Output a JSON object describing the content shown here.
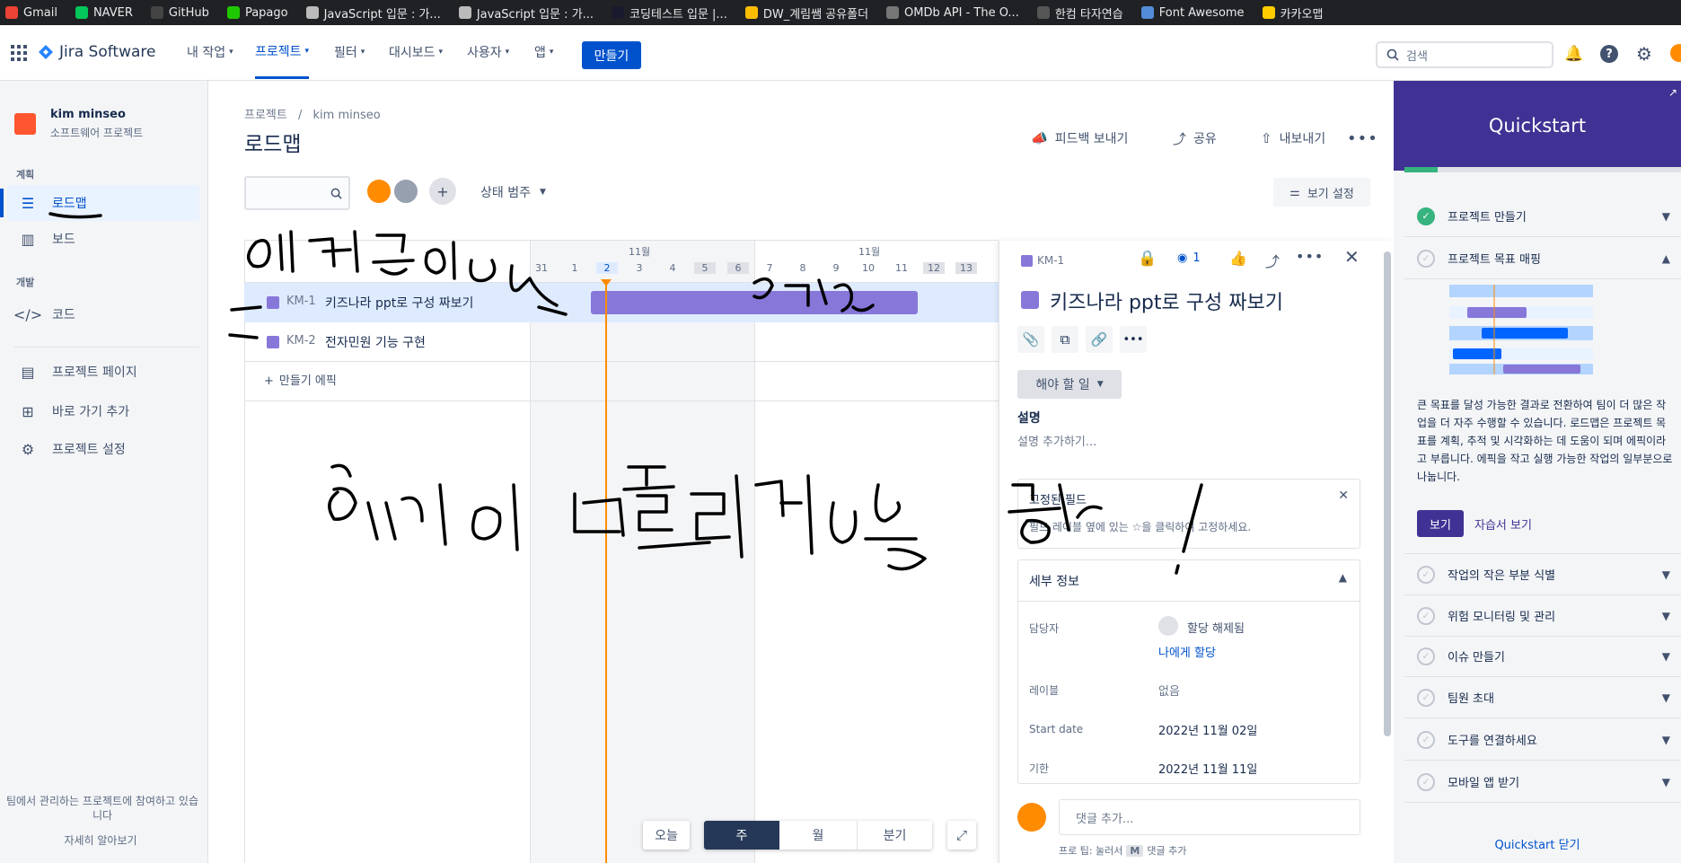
{
  "bookmarks": [
    {
      "label": "Gmail",
      "color": "#ea4335"
    },
    {
      "label": "NAVER",
      "color": "#03c75a"
    },
    {
      "label": "GitHub",
      "color": "#444"
    },
    {
      "label": "Papago",
      "color": "#1ec800"
    },
    {
      "label": "JavaScript 입문 : 가...",
      "color": "#bbb"
    },
    {
      "label": "JavaScript 입문 : 가...",
      "color": "#bbb"
    },
    {
      "label": "코딩테스트 입문 |...",
      "color": "#1a1a2e"
    },
    {
      "label": "DW_계림쌤 공유폴더",
      "color": "#fbbc04"
    },
    {
      "label": "OMDb API - The O...",
      "color": "#777"
    },
    {
      "label": "한컴 타자연습",
      "color": "#555"
    },
    {
      "label": "Font Awesome",
      "color": "#538dd7"
    },
    {
      "label": "카카오맵",
      "color": "#ffcd00"
    }
  ],
  "nav": {
    "brand": "Jira Software",
    "menus": [
      "내 작업",
      "프로젝트",
      "필터",
      "대시보드",
      "사용자",
      "앱"
    ],
    "create": "만들기",
    "search_placeholder": "검색"
  },
  "sidebar": {
    "project_name": "kim minseo",
    "project_type": "소프트웨어 프로젝트",
    "section_plan": "계획",
    "roadmap": "로드맵",
    "board": "보드",
    "section_dev": "개발",
    "code": "코드",
    "project_page": "프로젝트 페이지",
    "add_shortcut": "바로 가기 추가",
    "project_settings": "프로젝트 설정",
    "footer_text": "팀에서 관리하는 프로젝트에 참여하고 있습니다",
    "learn_more": "자세히 알아보기"
  },
  "main": {
    "breadcrumb_root": "프로젝트",
    "breadcrumb_sep": "/",
    "breadcrumb_project": "kim minseo",
    "title": "로드맵",
    "feedback": "피드백 보내기",
    "share": "공유",
    "export": "내보내기",
    "status_category": "상태 범주",
    "view_settings": "보기 설정",
    "month1": "11월",
    "month2": "11월",
    "days": [
      "31",
      "1",
      "2",
      "3",
      "4",
      "5",
      "6",
      "7",
      "8",
      "9",
      "10",
      "11",
      "12",
      "13"
    ],
    "rows": [
      {
        "key": "KM-1",
        "summary": "키즈나라 ppt로 구성 짜보기"
      },
      {
        "key": "KM-2",
        "summary": "전자민원 기능 구현"
      }
    ],
    "create_epic": "만들기 에픽",
    "today": "오늘",
    "scale": [
      "주",
      "월",
      "분기"
    ]
  },
  "panel": {
    "key": "KM-1",
    "watch_count": "1",
    "title": "키즈나라 ppt로 구성 짜보기",
    "status": "해야 할 일",
    "desc_label": "설명",
    "desc_placeholder": "설명 추가하기...",
    "pinned_title": "고정된 필드",
    "pinned_text": "필드 레이블 옆에 있는 ☆을 클릭하여 고정하세요.",
    "details_title": "세부 정보",
    "assignee_label": "담당자",
    "assignee_value": "할당 해제됨",
    "assign_me": "나에게 할당",
    "labels_label": "레이블",
    "labels_value": "없음",
    "start_label": "Start date",
    "start_value": "2022년 11월 02일",
    "due_label": "기한",
    "due_value": "2022년 11월 11일",
    "comment_placeholder": "댓글 추가...",
    "tip_prefix": "프로 팁: 눌러서",
    "tip_key": "M",
    "tip_suffix": "댓글 추가"
  },
  "quickstart": {
    "title": "Quickstart",
    "items": [
      {
        "label": "프로젝트 만들기",
        "done": true
      },
      {
        "label": "프로젝트 목표 매핑",
        "done": false,
        "open": true
      },
      {
        "label": "작업의 작은 부분 식별",
        "done": false
      },
      {
        "label": "위험 모니터링 및 관리",
        "done": false
      },
      {
        "label": "이슈 만들기",
        "done": false
      },
      {
        "label": "팀원 초대",
        "done": false
      },
      {
        "label": "도구를 연결하세요",
        "done": false
      },
      {
        "label": "모바일 앱 받기",
        "done": false
      }
    ],
    "body": "큰 목표를 달성 가능한 결과로 전환하여 팀이 더 많은 작업을 더 자주 수행할 수 있습니다. 로드맵은 프로젝트 목표를 계획, 추적 및 시각화하는 데 도움이 되며 에픽이라고 부릅니다. 에픽을 작고 실행 가능한 작업의 일부분으로 나눕니다.",
    "view": "보기",
    "tutorial": "자습서 보기",
    "close": "Quickstart 닫기"
  },
  "colors": {
    "brand": "#0052cc",
    "epic": "#8777d9",
    "today": "#ff8b00",
    "qs_header": "#403294"
  }
}
